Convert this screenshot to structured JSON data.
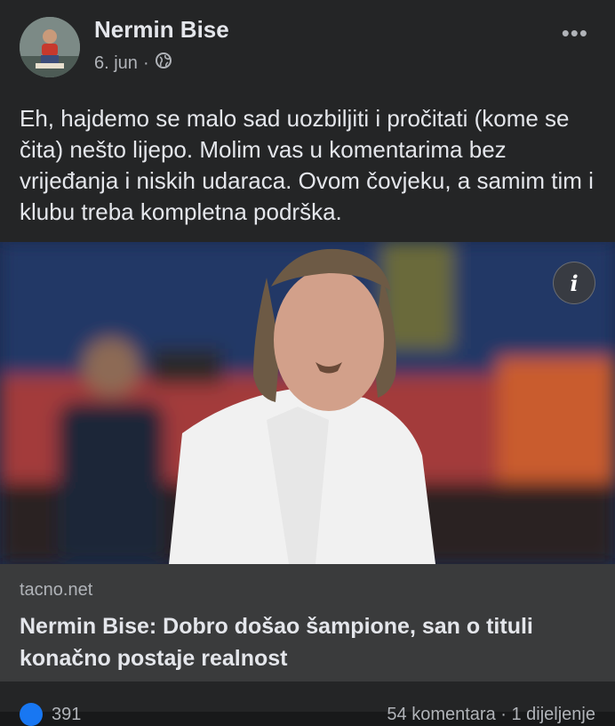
{
  "post": {
    "author": "Nermin Bise",
    "date": "6. jun",
    "separator": "·",
    "privacy_icon": "globe-icon",
    "more_icon": "more-options-icon",
    "text": "Eh, hajdemo se malo sad uozbiljiti i pročitati (kome se čita) nešto lijepo. Molim vas u komentarima bez vrijeđanja i niskih udaraca. Ovom čovjeku, a samim tim i klubu treba kompletna podrška."
  },
  "link": {
    "domain": "tacno.net",
    "title": "Nermin Bise: Dobro došao šampione, san o tituli konačno postaje realnost",
    "info_icon": "info-icon",
    "info_label": "i"
  },
  "footer": {
    "reaction_icon": "like-reaction-icon",
    "reaction_count": "391",
    "stats": "54 komentara · 1 dijeljenje"
  },
  "colors": {
    "background": "#18191a",
    "card": "#242526",
    "link_card": "#3a3b3c",
    "text_primary": "#e4e6eb",
    "text_secondary": "#b0b3b8",
    "accent": "#1877f2"
  }
}
